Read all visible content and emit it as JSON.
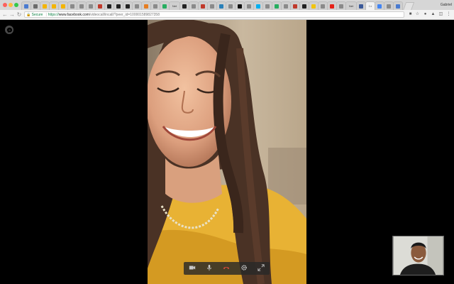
{
  "browser": {
    "profile_name": "Gabriel",
    "tabs": [
      {
        "icon": "apps-icon",
        "color": "#4a7bd0",
        "active": false
      },
      {
        "icon": "docs-icon",
        "color": "#6b6b6b",
        "active": false
      },
      {
        "icon": "keep-icon",
        "color": "#f4b400",
        "active": false
      },
      {
        "icon": "keep-icon",
        "color": "#f4b400",
        "active": false
      },
      {
        "icon": "keep-icon",
        "color": "#f4b400",
        "active": false
      },
      {
        "icon": "page-icon",
        "color": "#8a8a8a",
        "active": false
      },
      {
        "icon": "page-icon",
        "color": "#8a8a8a",
        "active": false
      },
      {
        "icon": "page-icon",
        "color": "#8a8a8a",
        "active": false
      },
      {
        "icon": "feather-icon",
        "color": "#c0392b",
        "active": false
      },
      {
        "icon": "github-icon",
        "color": "#222222",
        "active": false
      },
      {
        "icon": "github-icon",
        "color": "#222222",
        "active": false
      },
      {
        "icon": "github-icon",
        "color": "#222222",
        "active": false
      },
      {
        "icon": "page-icon",
        "color": "#8a8a8a",
        "active": false
      },
      {
        "icon": "orange-icon",
        "color": "#e67e22",
        "active": false
      },
      {
        "icon": "page-icon",
        "color": "#8a8a8a",
        "active": false
      },
      {
        "icon": "leaf-icon",
        "color": "#27ae60",
        "active": false
      },
      {
        "icon": "text-tab",
        "text": "Net",
        "active": false
      },
      {
        "icon": "github-icon",
        "color": "#222222",
        "active": false
      },
      {
        "icon": "page-icon",
        "color": "#8a8a8a",
        "active": false
      },
      {
        "icon": "red-square-icon",
        "color": "#c0392b",
        "active": false
      },
      {
        "icon": "page-icon",
        "color": "#8a8a8a",
        "active": false
      },
      {
        "icon": "blue-square-icon",
        "color": "#2980b9",
        "active": false
      },
      {
        "icon": "page-icon",
        "color": "#8a8a8a",
        "active": false
      },
      {
        "icon": "notion-icon",
        "color": "#111111",
        "active": false
      },
      {
        "icon": "page-icon",
        "color": "#8a8a8a",
        "active": false
      },
      {
        "icon": "skype-icon",
        "color": "#00aff0",
        "active": false
      },
      {
        "icon": "page-icon",
        "color": "#8a8a8a",
        "active": false
      },
      {
        "icon": "leaf-icon",
        "color": "#27ae60",
        "active": false
      },
      {
        "icon": "page-icon",
        "color": "#8a8a8a",
        "active": false
      },
      {
        "icon": "feather-icon",
        "color": "#c0392b",
        "active": false
      },
      {
        "icon": "github-icon",
        "color": "#222222",
        "active": false
      },
      {
        "icon": "yellow-icon",
        "color": "#f1c40f",
        "active": false
      },
      {
        "icon": "page-icon",
        "color": "#8a8a8a",
        "active": false
      },
      {
        "icon": "youtube-icon",
        "color": "#e62117",
        "active": false
      },
      {
        "icon": "page-icon",
        "color": "#8a8a8a",
        "active": false
      },
      {
        "icon": "text-tab",
        "text": "Net",
        "active": false
      },
      {
        "icon": "facebook-icon",
        "color": "#3b5998",
        "active": false
      },
      {
        "icon": "text-tab",
        "text": "I ×",
        "active": true
      },
      {
        "icon": "chrome-icon",
        "color": "#4285f4",
        "active": false
      },
      {
        "icon": "page-icon",
        "color": "#8a8a8a",
        "active": false
      },
      {
        "icon": "mail-icon",
        "color": "#4a7bd0",
        "active": false
      }
    ],
    "secure_label": "Secure",
    "url_scheme": "https://",
    "url_host": "www.facebook.com",
    "url_path": "/videocall/incall/?peer_id=100001589827358",
    "nav": {
      "back": "←",
      "forward": "→",
      "reload": "↻"
    }
  },
  "call": {
    "controls": [
      {
        "name": "camera-icon",
        "active": false
      },
      {
        "name": "microphone-icon",
        "active": false
      },
      {
        "name": "end-call-icon",
        "active": true
      },
      {
        "name": "settings-icon",
        "active": false
      },
      {
        "name": "fullscreen-icon",
        "active": false
      }
    ],
    "end_call_color": "#e74c3c",
    "control_color": "#c8c8c8"
  }
}
